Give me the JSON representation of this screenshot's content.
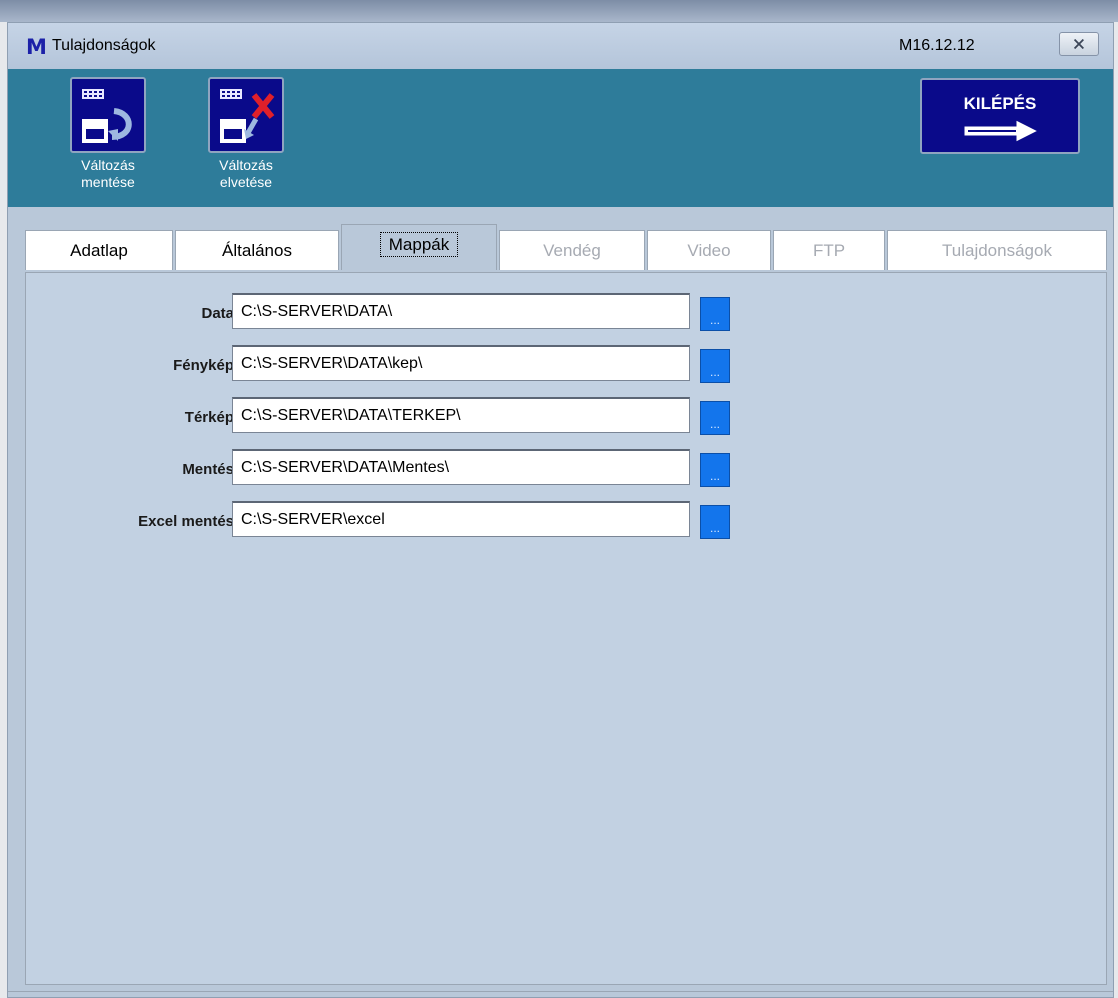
{
  "window": {
    "app_icon_letter": "M",
    "title": "Tulajdonságok",
    "version": "M16.12.12",
    "close_symbol": "🗙"
  },
  "toolbar": {
    "save": {
      "line1": "Változás",
      "line2": "mentése"
    },
    "discard": {
      "line1": "Változás",
      "line2": "elvetése"
    },
    "exit_label": "KILÉPÉS"
  },
  "tabs": [
    {
      "label": "Adatlap",
      "enabled": true
    },
    {
      "label": "Általános",
      "enabled": true
    },
    {
      "label": "Mappák",
      "enabled": true,
      "active": true
    },
    {
      "label": "Vendég",
      "enabled": false
    },
    {
      "label": "Video",
      "enabled": false
    },
    {
      "label": "FTP",
      "enabled": false
    },
    {
      "label": "Tulajdonságok",
      "enabled": false
    }
  ],
  "folders": [
    {
      "label": "Data",
      "value": "C:\\S-SERVER\\DATA\\"
    },
    {
      "label": "Fénykép",
      "value": "C:\\S-SERVER\\DATA\\kep\\"
    },
    {
      "label": "Térkép",
      "value": "C:\\S-SERVER\\DATA\\TERKEP\\"
    },
    {
      "label": "Mentés",
      "value": "C:\\S-SERVER\\DATA\\Mentes\\"
    },
    {
      "label": "Excel mentés",
      "value": "C:\\S-SERVER\\excel"
    }
  ],
  "browse_label": "...",
  "colors": {
    "toolbar_bg": "#2e7c9a",
    "button_navy": "#0a0a8a",
    "panel_bg": "#c2d1e2",
    "browse_blue": "#1375ec"
  }
}
